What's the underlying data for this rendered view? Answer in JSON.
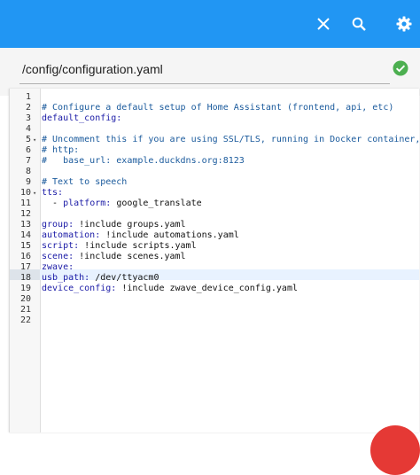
{
  "toolbar": {
    "icons": [
      "close-icon",
      "search-icon",
      "gear-icon"
    ],
    "accent": "#2196f3"
  },
  "file": {
    "path": "/config/configuration.yaml",
    "status_icon": "check-circle-icon",
    "status_color": "#4caf50"
  },
  "editor": {
    "active_line": 18,
    "lines": [
      {
        "n": "1",
        "fold": "",
        "parts": []
      },
      {
        "n": "2",
        "fold": "",
        "parts": [
          {
            "t": "comment",
            "v": "# Configure a default setup of Home Assistant (frontend, api, etc)"
          }
        ]
      },
      {
        "n": "3",
        "fold": "",
        "parts": [
          {
            "t": "key",
            "v": "default_config:"
          }
        ]
      },
      {
        "n": "4",
        "fold": "",
        "parts": []
      },
      {
        "n": "5",
        "fold": "▾",
        "parts": [
          {
            "t": "comment",
            "v": "# Uncomment this if you are using SSL/TLS, running in Docker container, etc."
          }
        ]
      },
      {
        "n": "6",
        "fold": "",
        "parts": [
          {
            "t": "comment",
            "v": "# http:"
          }
        ]
      },
      {
        "n": "7",
        "fold": "",
        "parts": [
          {
            "t": "comment",
            "v": "#   base_url: example.duckdns.org:8123"
          }
        ]
      },
      {
        "n": "8",
        "fold": "",
        "parts": []
      },
      {
        "n": "9",
        "fold": "",
        "parts": [
          {
            "t": "comment",
            "v": "# Text to speech"
          }
        ]
      },
      {
        "n": "10",
        "fold": "▾",
        "parts": [
          {
            "t": "key",
            "v": "tts:"
          }
        ]
      },
      {
        "n": "11",
        "fold": "",
        "parts": [
          {
            "t": "val",
            "v": "  - "
          },
          {
            "t": "key",
            "v": "platform: "
          },
          {
            "t": "val",
            "v": "google_translate"
          }
        ]
      },
      {
        "n": "12",
        "fold": "",
        "parts": []
      },
      {
        "n": "13",
        "fold": "",
        "parts": [
          {
            "t": "key",
            "v": "group: "
          },
          {
            "t": "val",
            "v": "!include groups.yaml"
          }
        ]
      },
      {
        "n": "14",
        "fold": "",
        "parts": [
          {
            "t": "key",
            "v": "automation: "
          },
          {
            "t": "val",
            "v": "!include automations.yaml"
          }
        ]
      },
      {
        "n": "15",
        "fold": "",
        "parts": [
          {
            "t": "key",
            "v": "script: "
          },
          {
            "t": "val",
            "v": "!include scripts.yaml"
          }
        ]
      },
      {
        "n": "16",
        "fold": "",
        "parts": [
          {
            "t": "key",
            "v": "scene: "
          },
          {
            "t": "val",
            "v": "!include scenes.yaml"
          }
        ]
      },
      {
        "n": "17",
        "fold": "",
        "parts": [
          {
            "t": "key",
            "v": "zwave:"
          }
        ]
      },
      {
        "n": "18",
        "fold": "",
        "parts": [
          {
            "t": "key",
            "v": "usb_path: "
          },
          {
            "t": "val",
            "v": "/dev/ttyacm0"
          }
        ]
      },
      {
        "n": "19",
        "fold": "",
        "parts": [
          {
            "t": "key",
            "v": "device_config: "
          },
          {
            "t": "val",
            "v": "!include zwave_device_config.yaml"
          }
        ]
      },
      {
        "n": "20",
        "fold": "",
        "parts": []
      },
      {
        "n": "21",
        "fold": "",
        "parts": []
      },
      {
        "n": "22",
        "fold": "",
        "parts": []
      }
    ]
  }
}
